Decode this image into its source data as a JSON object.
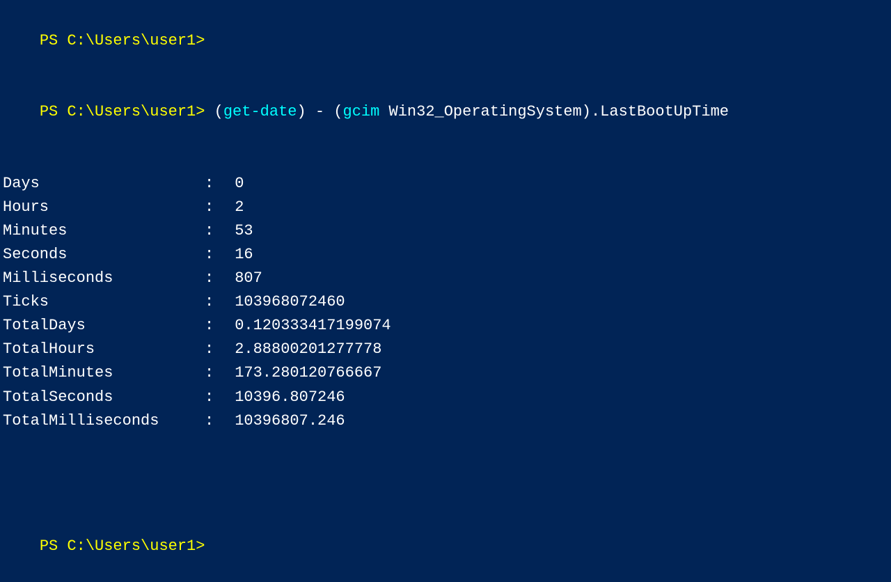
{
  "terminal": {
    "prompt1": "PS C:\\Users\\user1>",
    "prompt2": "PS C:\\Users\\user1>",
    "command": " (get-date) - (gcim Win32_OperatingSystem).LastBootUpTime",
    "cmd_keyword1": "get-date",
    "cmd_keyword2": "gcim",
    "rows": [
      {
        "label": "Days",
        "colon": ":",
        "value": "0"
      },
      {
        "label": "Hours",
        "colon": ":",
        "value": "2"
      },
      {
        "label": "Minutes",
        "colon": ":",
        "value": "53"
      },
      {
        "label": "Seconds",
        "colon": ":",
        "value": "16"
      },
      {
        "label": "Milliseconds",
        "colon": ":",
        "value": "807"
      },
      {
        "label": "Ticks",
        "colon": ":",
        "value": "103968072460"
      },
      {
        "label": "TotalDays",
        "colon": ":",
        "value": "0.120333417199074"
      },
      {
        "label": "TotalHours",
        "colon": ":",
        "value": "2.88800201277778"
      },
      {
        "label": "TotalMinutes",
        "colon": ":",
        "value": "173.280120766667"
      },
      {
        "label": "TotalSeconds",
        "colon": ":",
        "value": "10396.807246"
      },
      {
        "label": "TotalMilliseconds",
        "colon": ":",
        "value": "10396807.246"
      }
    ],
    "prompt3": "PS C:\\Users\\user1>"
  }
}
